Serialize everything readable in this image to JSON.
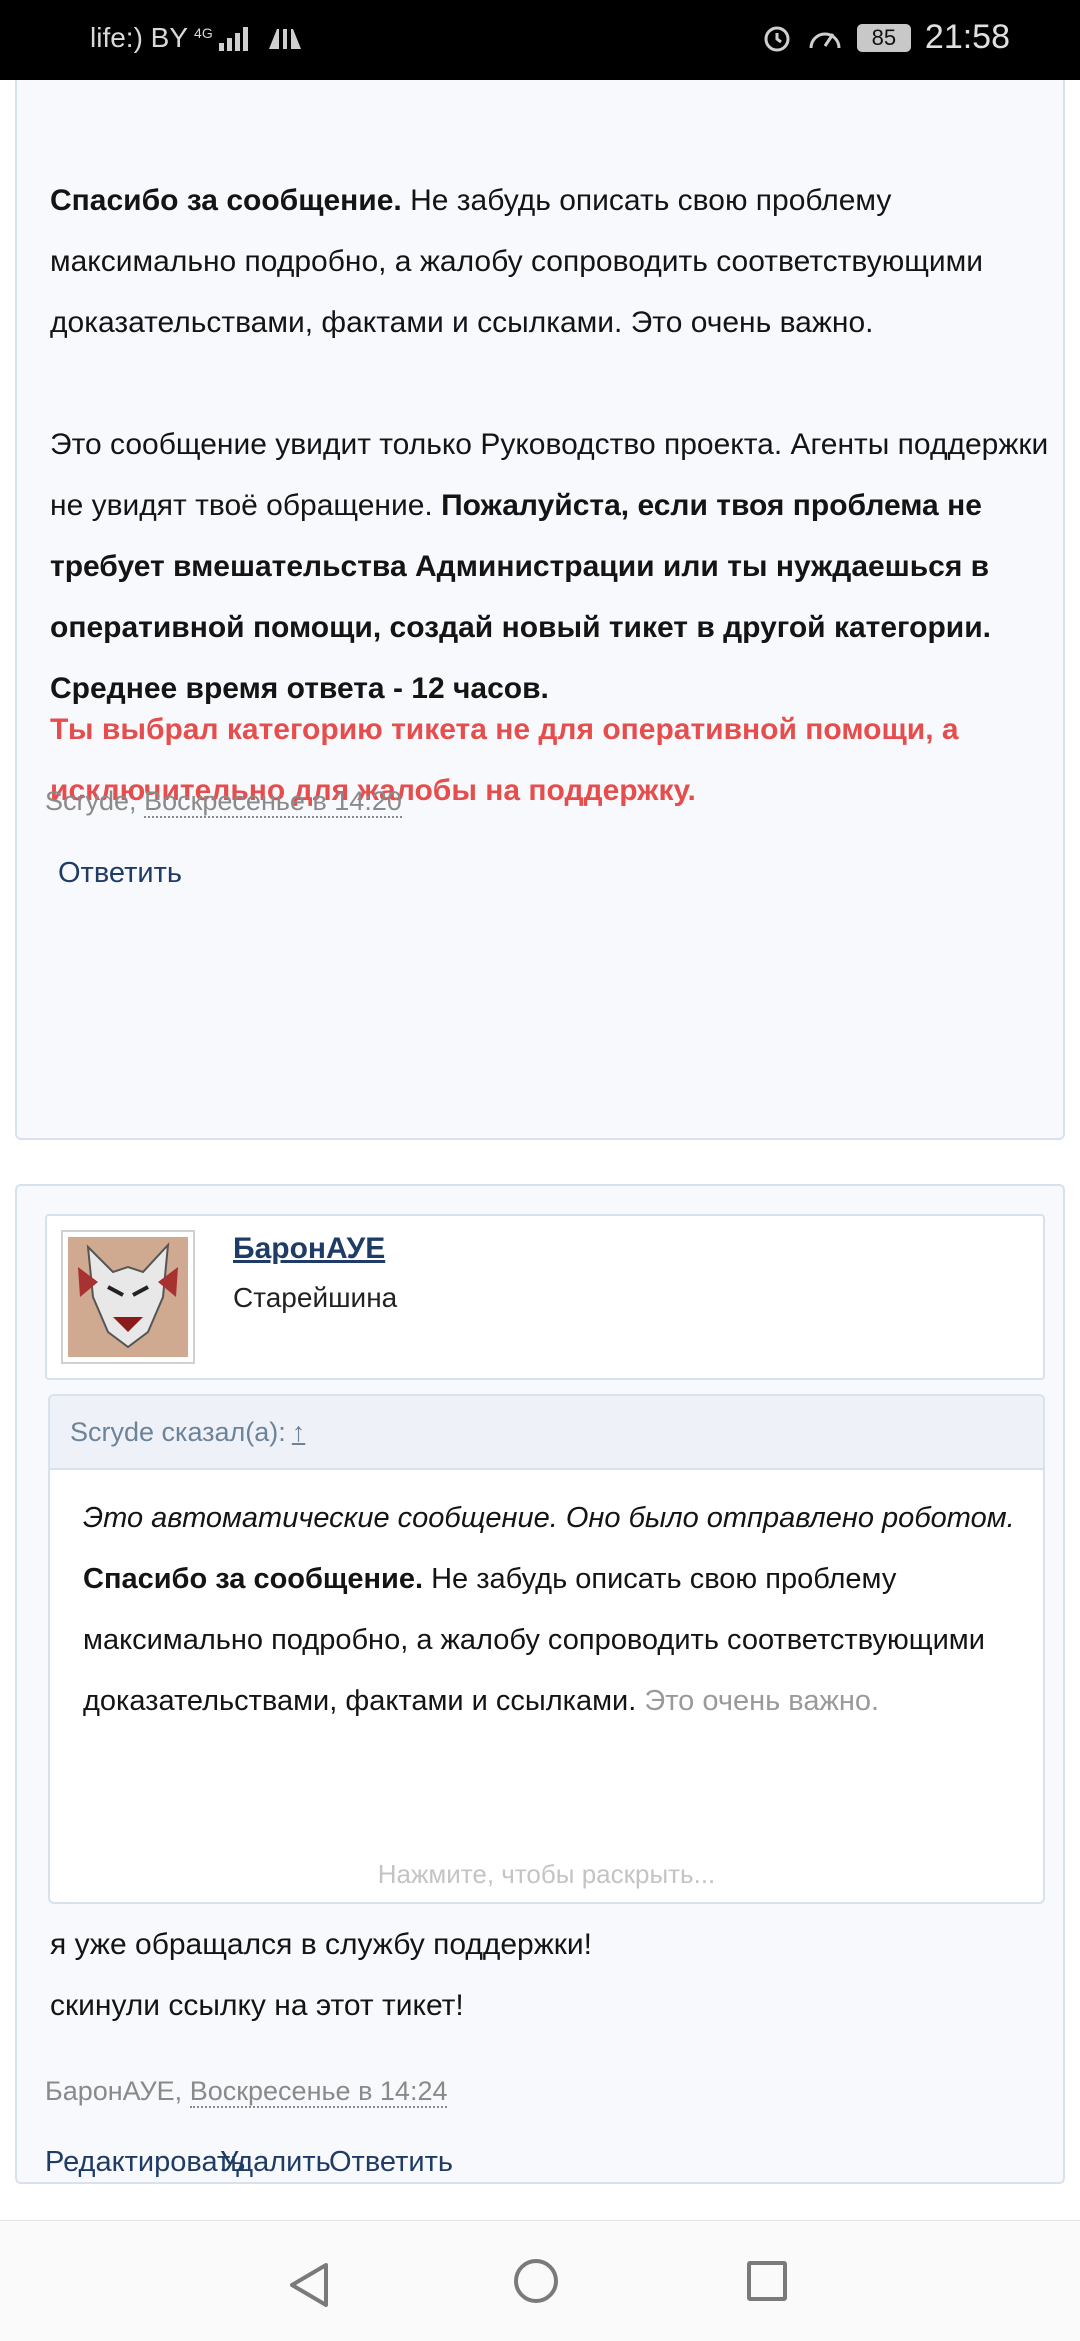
{
  "status_bar": {
    "carrier": "life:) BY",
    "network": "4G",
    "battery": "85",
    "time": "21:58"
  },
  "post1": {
    "para1_bold": "Спасибо за сообщение.",
    "para1_rest": " Не забудь описать свою проблему максимально подробно, а жалобу сопроводить соответствующими доказательствами, фактами и ссылками. Это очень важно.",
    "para2_normal": "Это сообщение увидит только Руководство проекта. Агенты поддержки не увидят твоё обращение. ",
    "para2_bold": "Пожалуйста, если твоя проблема не требует вмешательства Администрации или ты нуждаешься в оперативной помощи, создай новый тикет в другой категории.",
    "avg_time": "Среднее время ответа - 12 часов.",
    "red_notice": "Ты выбрал категорию тикета не для оперативной помощи, а исключительно для жалобы на поддержку.",
    "author": "Scryde",
    "date": "Воскресенье в 14:20",
    "reply_label": "Ответить"
  },
  "post2": {
    "author_name": "БаронАУЕ",
    "author_title": "Старейшина",
    "quote": {
      "header": "Scryde сказал(а):",
      "arrow": "↑",
      "italic_line": "Это автоматические сообщение. Оно было отправлено роботом.",
      "bold_start": "Спасибо за сообщение.",
      "rest": " Не забудь описать свою проблему максимально подробно, а жалобу сопроводить соответствующими доказательствами, фактами и ссылками.",
      "faded": "Это очень важно.",
      "expand": "Нажмите, чтобы раскрыть..."
    },
    "message_line1": "я уже обращался в службу поддержки!",
    "message_line2": "скинули ссылку на этот тикет!",
    "author": "БаронАУЕ",
    "date": "Воскресенье в 14:24",
    "actions": {
      "edit": "Редактировать",
      "delete": "Удалить",
      "reply": "Ответить"
    }
  },
  "nav": {
    "back": "back-icon",
    "home": "home-icon",
    "recent": "recent-apps-icon"
  }
}
